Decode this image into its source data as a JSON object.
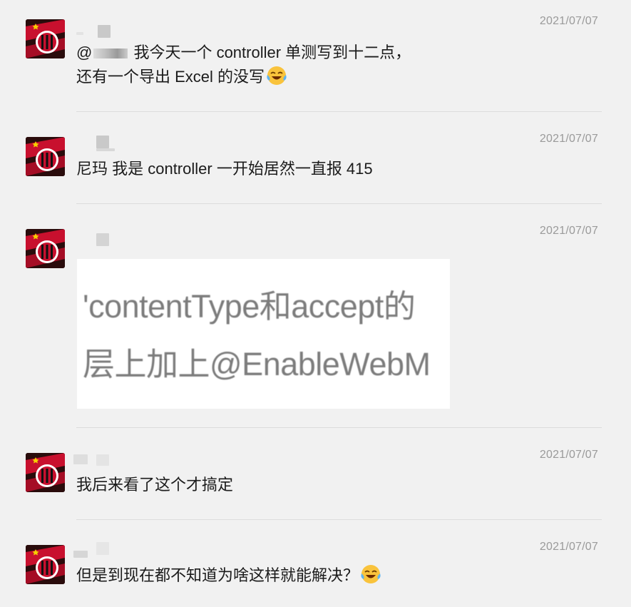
{
  "messages": [
    {
      "timestamp": "2021/07/07",
      "mention_prefix": "@",
      "line1": " 我今天一个 controller 单测写到十二点，",
      "line2": "还有一个导出 Excel 的没写",
      "emoji": "laughing-crying-emoji"
    },
    {
      "timestamp": "2021/07/07",
      "line1": "尼玛 我是 controller 一开始居然一直报 415"
    },
    {
      "timestamp": "2021/07/07",
      "image_lines": [
        "'contentType和accept的",
        "层上加上@EnableWebM"
      ]
    },
    {
      "timestamp": "2021/07/07",
      "line1": "我后来看了这个才搞定"
    },
    {
      "timestamp": "2021/07/07",
      "line1": "但是到现在都不知道为啥这样就能解决？",
      "emoji": "laughing-crying-emoji"
    }
  ],
  "colors": {
    "background": "#f1f1f1",
    "timestamp": "#9a9a9a",
    "divider": "#dcdcdc",
    "avatar_red": "#c8102e"
  }
}
